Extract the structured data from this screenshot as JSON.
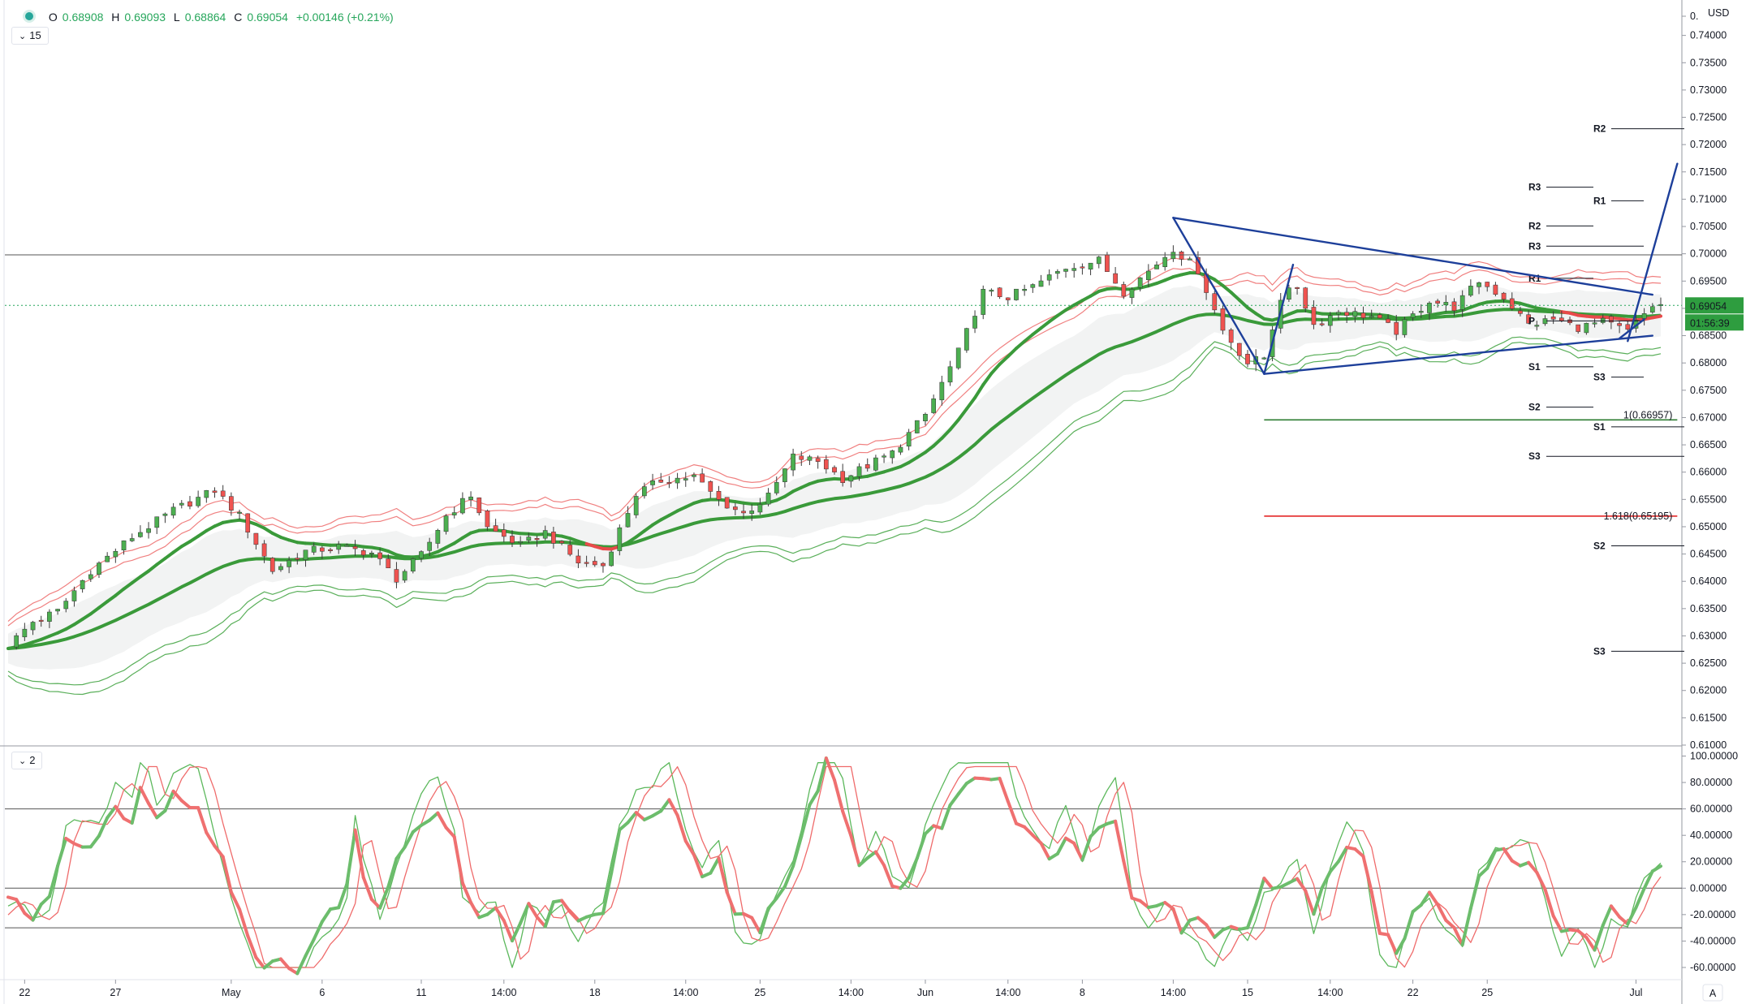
{
  "legend": {
    "open_label": "O",
    "open": "0.68908",
    "high_label": "H",
    "high": "0.69093",
    "low_label": "L",
    "low": "0.68864",
    "close_label": "C",
    "close": "0.69054",
    "change": "+0.00146 (+0.21%)"
  },
  "main_pane_button": "15",
  "osc_pane_button": "2",
  "currency": "USD",
  "price_tag": "0.69054",
  "countdown_tag": "01:56:39",
  "colors": {
    "up": "#4caf50",
    "down": "#ef5350",
    "band_red": "#f08080",
    "band_green": "#5aaf5a",
    "trend": "#1d3f9a",
    "tag_green": "#2e9d3f",
    "fib_red": "#e84a4a"
  },
  "chart_data": [
    {
      "type": "candlestick",
      "title": "",
      "ylabel": "",
      "y_ticks": [
        "0.",
        "0.74000",
        "0.73500",
        "0.73000",
        "0.72500",
        "0.72000",
        "0.71500",
        "0.71000",
        "0.70500",
        "0.70000",
        "0.69500",
        "0.69000",
        "0.68500",
        "0.68000",
        "0.67500",
        "0.67000",
        "0.66500",
        "0.66000",
        "0.65500",
        "0.65000",
        "0.64500",
        "0.64000",
        "0.63500",
        "0.63000",
        "0.62500",
        "0.62000",
        "0.61500",
        "0.61000"
      ],
      "ylim": [
        0.61,
        0.745
      ],
      "x_ticks": [
        "22",
        "27",
        "May",
        "6",
        "11",
        "14:00",
        "18",
        "14:00",
        "25",
        "14:00",
        "Jun",
        "14:00",
        "8",
        "14:00",
        "15",
        "14:00",
        "22",
        "25",
        "Jul"
      ],
      "last": 0.69054,
      "horizontal_line": 0.6998,
      "fib_levels": [
        {
          "label": "1(0.66957)",
          "value": 0.66957
        },
        {
          "label": "1.618(0.65195)",
          "value": 0.65195
        }
      ],
      "pivot_levels": [
        {
          "label": "R2",
          "value": 0.7229
        },
        {
          "label": "R3",
          "value": 0.7122
        },
        {
          "label": "R1",
          "value": 0.7097
        },
        {
          "label": "R2",
          "value": 0.7051
        },
        {
          "label": "R3",
          "value": 0.7014
        },
        {
          "label": "R1",
          "value": 0.6955
        },
        {
          "label": "P",
          "value": 0.6877
        },
        {
          "label": "S1",
          "value": 0.6793
        },
        {
          "label": "S3",
          "value": 0.6774
        },
        {
          "label": "S2",
          "value": 0.6719
        },
        {
          "label": "S1",
          "value": 0.6683
        },
        {
          "label": "S3",
          "value": 0.6629
        },
        {
          "label": "S2",
          "value": 0.6465
        },
        {
          "label": "S3",
          "value": 0.6272
        }
      ],
      "close_path": [
        [
          0,
          0.6282
        ],
        [
          3,
          0.6326
        ],
        [
          6,
          0.6345
        ],
        [
          10,
          0.642
        ],
        [
          15,
          0.6481
        ],
        [
          20,
          0.653
        ],
        [
          25,
          0.6567
        ],
        [
          28,
          0.652
        ],
        [
          32,
          0.642
        ],
        [
          36,
          0.6455
        ],
        [
          40,
          0.6463
        ],
        [
          44,
          0.6452
        ],
        [
          47,
          0.6405
        ],
        [
          50,
          0.6448
        ],
        [
          53,
          0.652
        ],
        [
          56,
          0.6558
        ],
        [
          58,
          0.6498
        ],
        [
          62,
          0.6466
        ],
        [
          65,
          0.649
        ],
        [
          69,
          0.6435
        ],
        [
          72,
          0.6429
        ],
        [
          76,
          0.656
        ],
        [
          79,
          0.6585
        ],
        [
          83,
          0.6592
        ],
        [
          86,
          0.6548
        ],
        [
          89,
          0.6524
        ],
        [
          92,
          0.6555
        ],
        [
          95,
          0.6628
        ],
        [
          98,
          0.662
        ],
        [
          101,
          0.6588
        ],
        [
          104,
          0.6612
        ],
        [
          107,
          0.6635
        ],
        [
          111,
          0.6705
        ],
        [
          115,
          0.682
        ],
        [
          118,
          0.693
        ],
        [
          121,
          0.6921
        ],
        [
          124,
          0.694
        ],
        [
          128,
          0.6975
        ],
        [
          132,
          0.6988
        ],
        [
          135,
          0.693
        ],
        [
          138,
          0.6968
        ],
        [
          141,
          0.701
        ],
        [
          144,
          0.697
        ],
        [
          147,
          0.686
        ],
        [
          150,
          0.68
        ],
        [
          152,
          0.681
        ],
        [
          154,
          0.692
        ],
        [
          156,
          0.694
        ],
        [
          158,
          0.687
        ],
        [
          161,
          0.6895
        ],
        [
          165,
          0.6885
        ],
        [
          168,
          0.6858
        ],
        [
          172,
          0.6915
        ],
        [
          175,
          0.6902
        ],
        [
          178,
          0.695
        ],
        [
          181,
          0.692
        ],
        [
          184,
          0.687
        ],
        [
          187,
          0.688
        ],
        [
          190,
          0.6865
        ],
        [
          193,
          0.6875
        ],
        [
          196,
          0.6858
        ],
        [
          199,
          0.6905
        ]
      ],
      "trendlines": [
        {
          "from": [
            141,
            0.7066
          ],
          "to": [
            152,
            0.678
          ]
        },
        {
          "from": [
            152,
            0.678
          ],
          "to": [
            155.5,
            0.698
          ]
        },
        {
          "from": [
            141,
            0.7066
          ],
          "to": [
            199,
            0.6925
          ]
        },
        {
          "from": [
            152,
            0.678
          ],
          "to": [
            199,
            0.685
          ]
        },
        {
          "from": [
            195,
            0.6845
          ],
          "to": [
            198,
            0.688
          ]
        },
        {
          "from": [
            196,
            0.684
          ],
          "to": [
            202,
            0.7165
          ]
        }
      ]
    },
    {
      "type": "line",
      "title": "",
      "ylabel": "",
      "y_ticks": [
        "100.00000",
        "80.00000",
        "60.00000",
        "40.00000",
        "20.00000",
        "0.00000",
        "-20.00000",
        "-40.00000",
        "-60.00000"
      ],
      "ylim": [
        -68,
        104
      ],
      "h_lines": [
        60,
        0,
        -30
      ],
      "series_path": [
        [
          0,
          -10
        ],
        [
          3,
          -20
        ],
        [
          5,
          -5
        ],
        [
          7,
          35
        ],
        [
          9,
          30
        ],
        [
          11,
          40
        ],
        [
          13,
          65
        ],
        [
          15,
          45
        ],
        [
          16,
          75
        ],
        [
          18,
          50
        ],
        [
          20,
          70
        ],
        [
          23,
          60
        ],
        [
          26,
          20
        ],
        [
          28,
          -20
        ],
        [
          30,
          -55
        ],
        [
          33,
          -58
        ],
        [
          35,
          -65
        ],
        [
          37,
          -40
        ],
        [
          39,
          -20
        ],
        [
          41,
          0
        ],
        [
          42,
          40
        ],
        [
          43,
          10
        ],
        [
          45,
          -20
        ],
        [
          47,
          20
        ],
        [
          49,
          40
        ],
        [
          52,
          60
        ],
        [
          54,
          40
        ],
        [
          55,
          0
        ],
        [
          57,
          -20
        ],
        [
          59,
          -10
        ],
        [
          61,
          -40
        ],
        [
          63,
          -10
        ],
        [
          65,
          -25
        ],
        [
          67,
          -5
        ],
        [
          69,
          -25
        ],
        [
          72,
          -15
        ],
        [
          74,
          40
        ],
        [
          76,
          60
        ],
        [
          78,
          50
        ],
        [
          80,
          70
        ],
        [
          82,
          40
        ],
        [
          84,
          10
        ],
        [
          86,
          20
        ],
        [
          88,
          -20
        ],
        [
          91,
          -30
        ],
        [
          93,
          -10
        ],
        [
          95,
          20
        ],
        [
          97,
          60
        ],
        [
          99,
          95
        ],
        [
          101,
          60
        ],
        [
          103,
          20
        ],
        [
          105,
          30
        ],
        [
          107,
          0
        ],
        [
          109,
          5
        ],
        [
          111,
          40
        ],
        [
          113,
          50
        ],
        [
          115,
          70
        ],
        [
          117,
          80
        ],
        [
          120,
          80
        ],
        [
          122,
          50
        ],
        [
          124,
          40
        ],
        [
          126,
          20
        ],
        [
          128,
          40
        ],
        [
          130,
          20
        ],
        [
          132,
          50
        ],
        [
          134,
          55
        ],
        [
          136,
          -5
        ],
        [
          138,
          -15
        ],
        [
          140,
          -10
        ],
        [
          142,
          -30
        ],
        [
          144,
          -25
        ],
        [
          146,
          -40
        ],
        [
          148,
          -30
        ],
        [
          150,
          -30
        ],
        [
          152,
          5
        ],
        [
          154,
          0
        ],
        [
          156,
          10
        ],
        [
          158,
          -20
        ],
        [
          160,
          15
        ],
        [
          162,
          30
        ],
        [
          164,
          20
        ],
        [
          166,
          -30
        ],
        [
          168,
          -50
        ],
        [
          170,
          -20
        ],
        [
          172,
          0
        ],
        [
          174,
          -20
        ],
        [
          176,
          -40
        ],
        [
          178,
          10
        ],
        [
          180,
          30
        ],
        [
          182,
          20
        ],
        [
          184,
          20
        ],
        [
          186,
          0
        ],
        [
          188,
          -35
        ],
        [
          190,
          -30
        ],
        [
          192,
          -45
        ],
        [
          194,
          -10
        ],
        [
          196,
          -25
        ],
        [
          198,
          0
        ],
        [
          200,
          20
        ]
      ]
    }
  ]
}
